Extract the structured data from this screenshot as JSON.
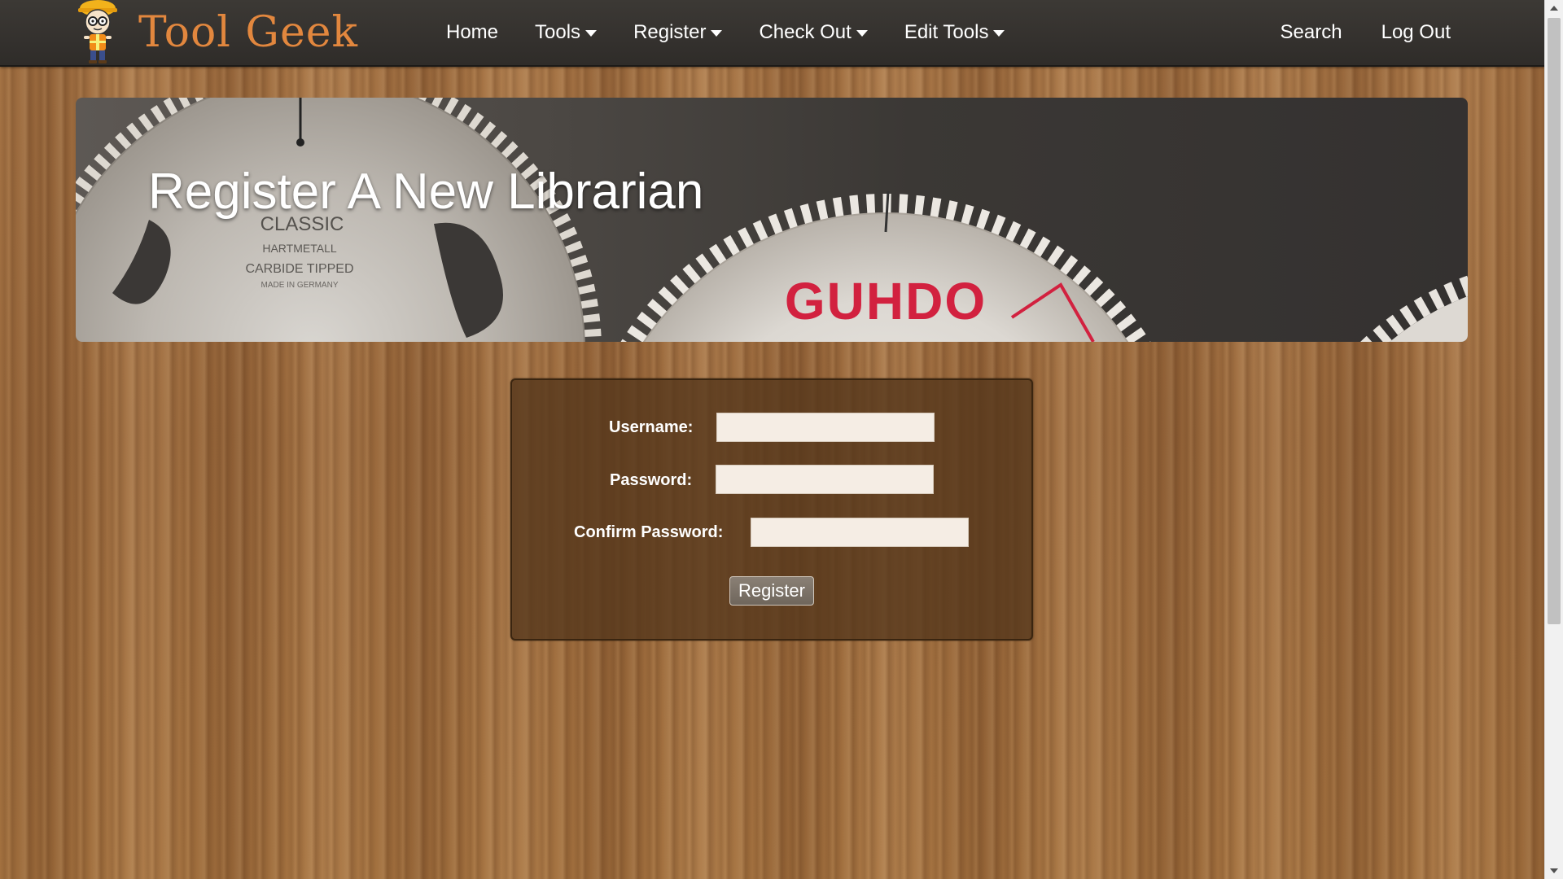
{
  "brand": {
    "name": "Tool Geek",
    "accent_color": "#e2873e",
    "logo_icon": "construction-worker-mascot-icon"
  },
  "nav": {
    "items": [
      {
        "label": "Home",
        "has_dropdown": false
      },
      {
        "label": "Tools",
        "has_dropdown": true
      },
      {
        "label": "Register",
        "has_dropdown": true
      },
      {
        "label": "Check Out",
        "has_dropdown": true
      },
      {
        "label": "Edit Tools",
        "has_dropdown": true
      }
    ],
    "right_items": [
      {
        "label": "Search"
      },
      {
        "label": "Log Out"
      }
    ]
  },
  "banner": {
    "title": "Register A New Librarian",
    "blade_left_text": [
      "CLASSIC",
      "HARTMETALL",
      "CARBIDE TIPPED",
      "MADE IN GERMANY"
    ],
    "blade_right_text": "GUHDO"
  },
  "form": {
    "username_label": "Username:",
    "password_label": "Password:",
    "confirm_label": "Confirm Password:",
    "username_value": "",
    "password_value": "",
    "confirm_value": "",
    "submit_label": "Register"
  },
  "colors": {
    "nav_bg": "#35322f",
    "panel_bg": "#55371c",
    "wood": "#9a6a3e",
    "guhdo_red": "#d2213f"
  }
}
